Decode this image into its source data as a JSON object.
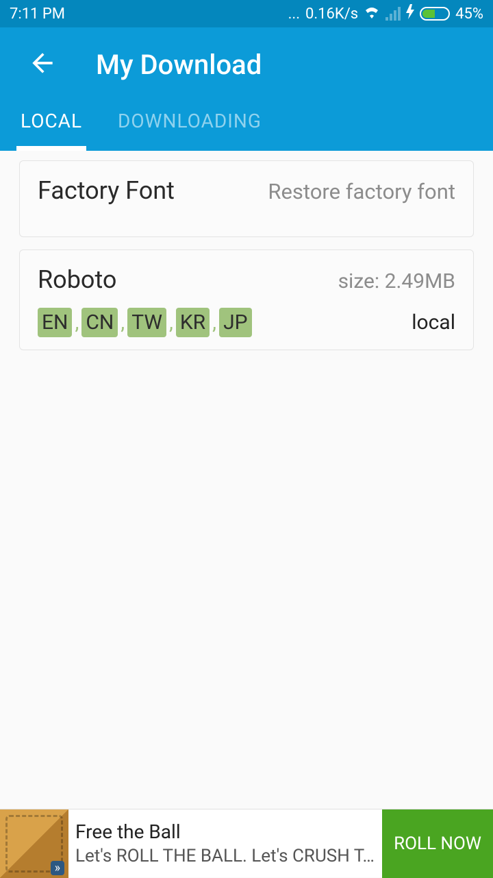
{
  "statusbar": {
    "time": "7:11 PM",
    "speed": "0.16K/s",
    "dots": "...",
    "battery_pct": "45%"
  },
  "header": {
    "title": "My Download"
  },
  "tabs": {
    "local": "LOCAL",
    "downloading": "DOWNLOADING"
  },
  "cards": {
    "factory": {
      "title": "Factory Font",
      "action": "Restore factory font"
    },
    "roboto": {
      "title": "Roboto",
      "size": "size: 2.49MB",
      "status": "local",
      "tags": [
        "EN",
        "CN",
        "TW",
        "KR",
        "JP"
      ]
    }
  },
  "ad": {
    "title": "Free the Ball",
    "subtitle": "Let's ROLL THE BALL. Let's CRUSH T…",
    "button": "ROLL NOW"
  }
}
